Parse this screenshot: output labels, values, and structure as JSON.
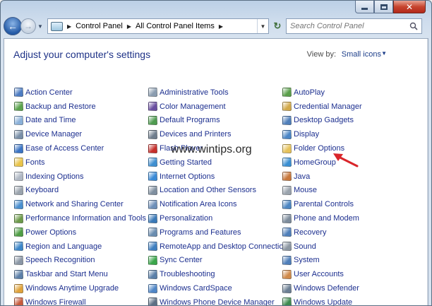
{
  "window": {
    "caption_buttons": [
      "minimize",
      "maximize",
      "close"
    ],
    "close_color": "#c7452f"
  },
  "nav": {
    "breadcrumbs": [
      "Control Panel",
      "All Control Panel Items"
    ],
    "search": {
      "placeholder": "Search Control Panel"
    }
  },
  "header": {
    "title": "Adjust your computer's settings",
    "view_by_label": "View by:",
    "view_by_value": "Small icons"
  },
  "watermark": "www.wintips.org",
  "accent_arrow_color": "#d9252a",
  "columns": [
    [
      {
        "label": "Action Center",
        "icon": "flag-icon",
        "color": "#4d7cc2"
      },
      {
        "label": "Backup and Restore",
        "icon": "backup-icon",
        "color": "#5ba34d"
      },
      {
        "label": "Date and Time",
        "icon": "clock-icon",
        "color": "#8ab0d8"
      },
      {
        "label": "Device Manager",
        "icon": "device-manager-icon",
        "color": "#7a8fa8"
      },
      {
        "label": "Ease of Access Center",
        "icon": "ease-of-access-icon",
        "color": "#3b74c4"
      },
      {
        "label": "Fonts",
        "icon": "fonts-icon",
        "color": "#e9c44a"
      },
      {
        "label": "Indexing Options",
        "icon": "indexing-icon",
        "color": "#b0b8c4"
      },
      {
        "label": "Keyboard",
        "icon": "keyboard-icon",
        "color": "#9aa3ad"
      },
      {
        "label": "Network and Sharing Center",
        "icon": "network-icon",
        "color": "#4a8fcf"
      },
      {
        "label": "Performance Information and Tools",
        "icon": "performance-icon",
        "color": "#6c9a4a"
      },
      {
        "label": "Power Options",
        "icon": "power-icon",
        "color": "#4f9e45"
      },
      {
        "label": "Region and Language",
        "icon": "globe-icon",
        "color": "#3c86c9"
      },
      {
        "label": "Speech Recognition",
        "icon": "microphone-icon",
        "color": "#8a96a5"
      },
      {
        "label": "Taskbar and Start Menu",
        "icon": "taskbar-icon",
        "color": "#5c7fa8"
      },
      {
        "label": "Windows Anytime Upgrade",
        "icon": "windows-flag-icon",
        "color": "#e0a23a"
      },
      {
        "label": "Windows Firewall",
        "icon": "firewall-icon",
        "color": "#c75a3c"
      }
    ],
    [
      {
        "label": "Administrative Tools",
        "icon": "admin-tools-icon",
        "color": "#8b9db0"
      },
      {
        "label": "Color Management",
        "icon": "color-management-icon",
        "color": "#6a4fa0"
      },
      {
        "label": "Default Programs",
        "icon": "default-programs-icon",
        "color": "#4e9b4f"
      },
      {
        "label": "Devices and Printers",
        "icon": "printer-icon",
        "color": "#6f7d8c"
      },
      {
        "label": "Flash Player",
        "icon": "flash-icon",
        "color": "#c62f2b"
      },
      {
        "label": "Getting Started",
        "icon": "getting-started-icon",
        "color": "#3f8fd0"
      },
      {
        "label": "Internet Options",
        "icon": "internet-options-icon",
        "color": "#3a8ad6"
      },
      {
        "label": "Location and Other Sensors",
        "icon": "sensors-icon",
        "color": "#7f8f9f"
      },
      {
        "label": "Notification Area Icons",
        "icon": "notification-icon",
        "color": "#6d8fb8"
      },
      {
        "label": "Personalization",
        "icon": "personalization-icon",
        "color": "#3a7ab8"
      },
      {
        "label": "Programs and Features",
        "icon": "programs-icon",
        "color": "#6a8db0"
      },
      {
        "label": "RemoteApp and Desktop Connections",
        "icon": "remoteapp-icon",
        "color": "#3f7fc0"
      },
      {
        "label": "Sync Center",
        "icon": "sync-icon",
        "color": "#3aa64a"
      },
      {
        "label": "Troubleshooting",
        "icon": "troubleshooting-icon",
        "color": "#5a7fa8"
      },
      {
        "label": "Windows CardSpace",
        "icon": "cardspace-icon",
        "color": "#4f86c7"
      },
      {
        "label": "Windows Phone Device Manager",
        "icon": "phone-icon",
        "color": "#5c6f84"
      }
    ],
    [
      {
        "label": "AutoPlay",
        "icon": "autoplay-icon",
        "color": "#5a9f4a"
      },
      {
        "label": "Credential Manager",
        "icon": "credential-icon",
        "color": "#d2a94a"
      },
      {
        "label": "Desktop Gadgets",
        "icon": "gadgets-icon",
        "color": "#4f7fba"
      },
      {
        "label": "Display",
        "icon": "display-icon",
        "color": "#4b86c6"
      },
      {
        "label": "Folder Options",
        "icon": "folder-icon",
        "color": "#e6c25a"
      },
      {
        "label": "HomeGroup",
        "icon": "homegroup-icon",
        "color": "#3a8fd2"
      },
      {
        "label": "Java",
        "icon": "java-icon",
        "color": "#c9783c"
      },
      {
        "label": "Mouse",
        "icon": "mouse-icon",
        "color": "#9aa3ad"
      },
      {
        "label": "Parental Controls",
        "icon": "parental-controls-icon",
        "color": "#4c86c2"
      },
      {
        "label": "Phone and Modem",
        "icon": "modem-icon",
        "color": "#7d8c9c"
      },
      {
        "label": "Recovery",
        "icon": "recovery-icon",
        "color": "#4f7fba"
      },
      {
        "label": "Sound",
        "icon": "sound-icon",
        "color": "#8d97a2"
      },
      {
        "label": "System",
        "icon": "system-icon",
        "color": "#4f7fba"
      },
      {
        "label": "User Accounts",
        "icon": "user-accounts-icon",
        "color": "#d08a4a"
      },
      {
        "label": "Windows Defender",
        "icon": "defender-icon",
        "color": "#6c7f94"
      },
      {
        "label": "Windows Update",
        "icon": "windows-update-icon",
        "color": "#3f8a4f"
      }
    ]
  ]
}
